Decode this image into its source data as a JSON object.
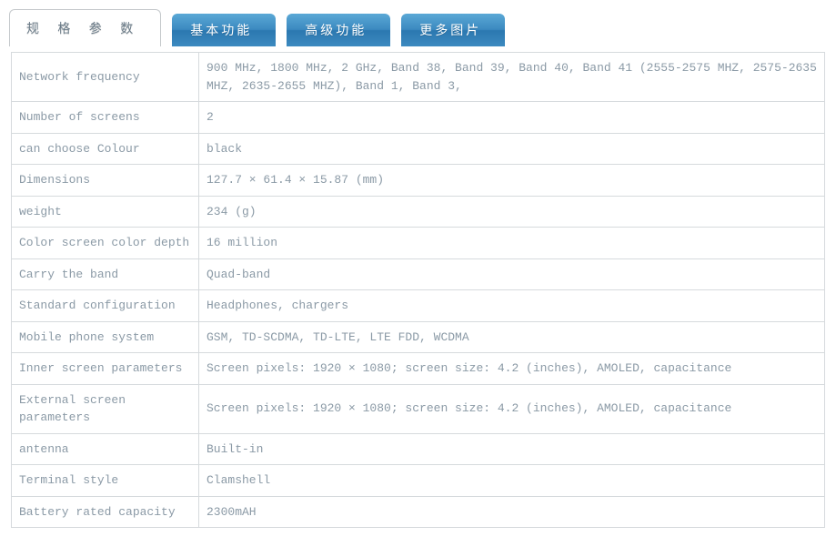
{
  "tabs": {
    "active": "规 格 参 数",
    "items": [
      "基本功能",
      "高级功能",
      "更多图片"
    ]
  },
  "specs": [
    {
      "label": "Network frequency",
      "value": "900 MHz, 1800 MHz, 2 GHz, Band 38, Band 39, Band 40, Band 41 (2555-2575 MHZ, 2575-2635 MHZ, 2635-2655 MHZ), Band 1, Band 3,"
    },
    {
      "label": "Number of screens",
      "value": "2"
    },
    {
      "label": "can choose Colour",
      "value": "black"
    },
    {
      "label": "Dimensions",
      "value": "127.7 × 61.4 × 15.87 (mm)"
    },
    {
      "label": "weight",
      "value": "234 (g)"
    },
    {
      "label": "Color screen color depth",
      "value": "16 million"
    },
    {
      "label": "Carry the band",
      "value": "Quad-band"
    },
    {
      "label": "Standard configuration",
      "value": "Headphones, chargers"
    },
    {
      "label": "Mobile phone system",
      "value": "GSM, TD-SCDMA, TD-LTE, LTE FDD, WCDMA"
    },
    {
      "label": "Inner screen parameters",
      "value": "Screen pixels: 1920 × 1080; screen size: 4.2 (inches), AMOLED, capacitance"
    },
    {
      "label": "External screen parameters",
      "value": "Screen pixels: 1920 × 1080; screen size: 4.2 (inches), AMOLED, capacitance"
    },
    {
      "label": "antenna",
      "value": "Built-in"
    },
    {
      "label": "Terminal style",
      "value": "Clamshell"
    },
    {
      "label": "Battery rated capacity",
      "value": "2300mAH"
    }
  ]
}
